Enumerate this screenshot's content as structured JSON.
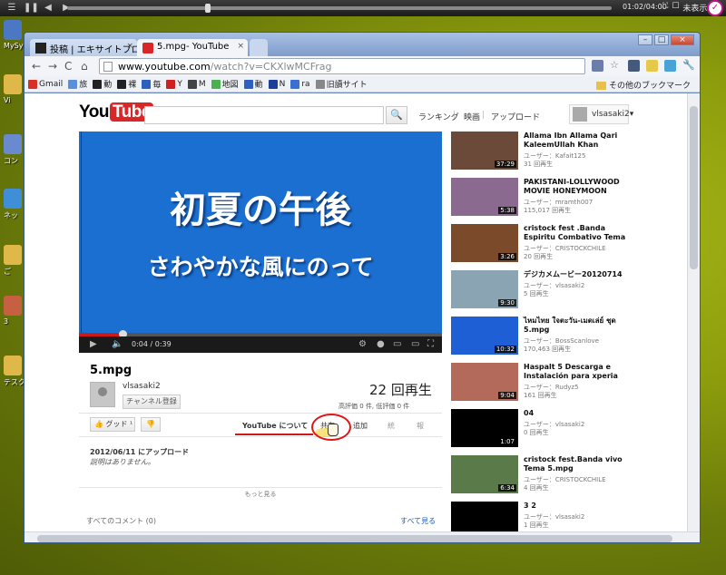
{
  "player": {
    "time": "01:02/04:00",
    "right_label": "未表示",
    "progress_fraction": 0.26
  },
  "desktop": {
    "icons": [
      {
        "label": "MySy",
        "color": "#4a78c4"
      },
      {
        "label": "Vi",
        "color": "#e0b84a"
      },
      {
        "label": "コン",
        "color": "#6a8ad0"
      },
      {
        "label": "ネッ",
        "color": "#3e8fd8"
      },
      {
        "label": "ご",
        "color": "#e0b84a"
      },
      {
        "label": "3",
        "color": "#c76040"
      },
      {
        "label": "テスク",
        "color": "#e0b84a"
      }
    ]
  },
  "browser": {
    "tabs": [
      {
        "label": "投稿 | エキサイトブログ"
      },
      {
        "label": "5.mpg- YouTube"
      }
    ],
    "url_host": "www.youtube.com",
    "url_path": "/watch?v=CKXlwMCFrag",
    "bookmarks": [
      {
        "label": "Gmail",
        "color": "#d93025"
      },
      {
        "label": "旅",
        "color": "#5b8fd9"
      },
      {
        "label": "動",
        "color": "#222222"
      },
      {
        "label": "裸",
        "color": "#222222"
      },
      {
        "label": "毎",
        "color": "#2c5fbf"
      },
      {
        "label": "Y",
        "color": "#d02020"
      },
      {
        "label": "M",
        "color": "#444444"
      },
      {
        "label": "地図",
        "color": "#4caf50"
      },
      {
        "label": "動",
        "color": "#2c5fbf"
      },
      {
        "label": "N",
        "color": "#1e3f99"
      },
      {
        "label": "ra",
        "color": "#3b6fd0"
      },
      {
        "label": "旧讀サイト",
        "color": "#888888"
      }
    ],
    "other_bookmarks": "その他のブックマーク"
  },
  "youtube": {
    "logo_you": "You",
    "logo_tube": "Tube",
    "nav": [
      "ランキング",
      "映画",
      "アップロード"
    ],
    "username": "vlsasaki2",
    "video": {
      "line1": "初夏の午後",
      "line2": "さわやかな風にのって",
      "time": "0:04 / 0:39",
      "progress_fraction": 0.12
    },
    "title": "5.mpg",
    "owner": "vlsasaki2",
    "subscribe": "チャンネル登録",
    "views": "22 回再生",
    "likes": "高評価 0 件, 低評価 0 件",
    "like_label": "グッド",
    "tabs": [
      "YouTube について",
      "共有",
      "追加",
      "統",
      "報"
    ],
    "upload_date": "2012/06/11 にアップロード",
    "description": "説明はありません。",
    "more": "もっと見る",
    "comments": "すべてのコメント (0)",
    "see_all": "すべて見る",
    "related": [
      {
        "title": "Allama Ibn Allama Qari KaleemUllah Khan",
        "user": "ユーザー：Kafait125",
        "views": "31 回再生",
        "duration": "37:29",
        "thumb": "#6b4a3a"
      },
      {
        "title": "PAKISTANI-LOLLYWOOD MOVIE HONEYMOON",
        "user": "ユーザー：mramth007",
        "views": "115,017 回再生",
        "duration": "5:38",
        "thumb": "#8a6a8e"
      },
      {
        "title": "cristock fest .Banda Espiritu Combativo Tema",
        "user": "ユーザー：CRISTOCKCHILE",
        "views": "20 回再生",
        "duration": "3:26",
        "thumb": "#7a4a2a"
      },
      {
        "title": "デジカメムービー20120714",
        "user": "ユーザー：vlsasaki2",
        "views": "5 回再生",
        "duration": "9:30",
        "thumb": "#8aa4b4"
      },
      {
        "title": "ไหมไทย ใจตะวัน-เมดเล่ย์ ชุด 5.mpg",
        "user": "ユーザー：BossScanlove",
        "views": "170,463 回再生",
        "duration": "10:32",
        "thumb": "#1f5fd6"
      },
      {
        "title": "Haspalt 5 Descarga e Instalación para xperia",
        "user": "ユーザー：Rudyz5",
        "views": "161 回再生",
        "duration": "9:04",
        "thumb": "#b46a5a"
      },
      {
        "title": "04",
        "user": "ユーザー：vlsasaki2",
        "views": "0 回再生",
        "duration": "1:07",
        "thumb": "#000000"
      },
      {
        "title": "cristock fest.Banda vivo Tema 5.mpg",
        "user": "ユーザー：CRISTOCKCHILE",
        "views": "4 回再生",
        "duration": "6:34",
        "thumb": "#5a7a4a"
      },
      {
        "title": "3 2",
        "user": "ユーザー：vlsasaki2",
        "views": "1 回再生",
        "duration": "",
        "thumb": "#000000"
      }
    ]
  },
  "colors": {
    "accent_red": "#cc1a1a",
    "video_bg": "#1b6fd1",
    "link_blue": "#1b5fb8"
  }
}
